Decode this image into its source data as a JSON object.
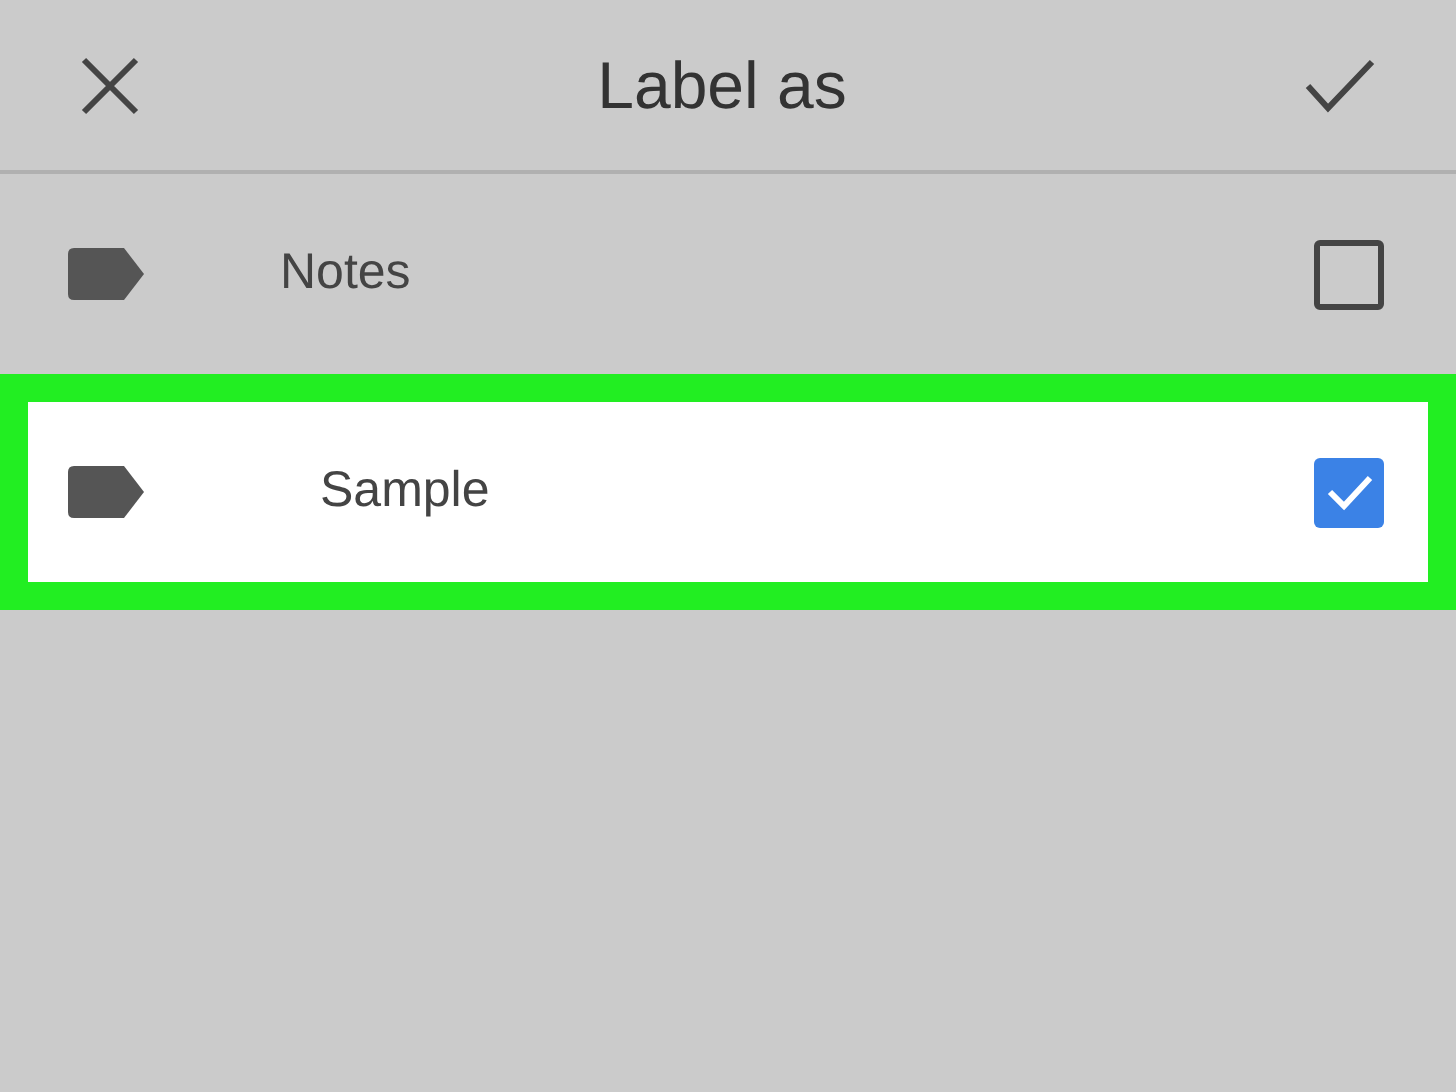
{
  "header": {
    "title": "Label as"
  },
  "labels": [
    {
      "name": "Notes",
      "checked": false,
      "selected": false
    },
    {
      "name": "Sample",
      "checked": true,
      "selected": true
    }
  ]
}
